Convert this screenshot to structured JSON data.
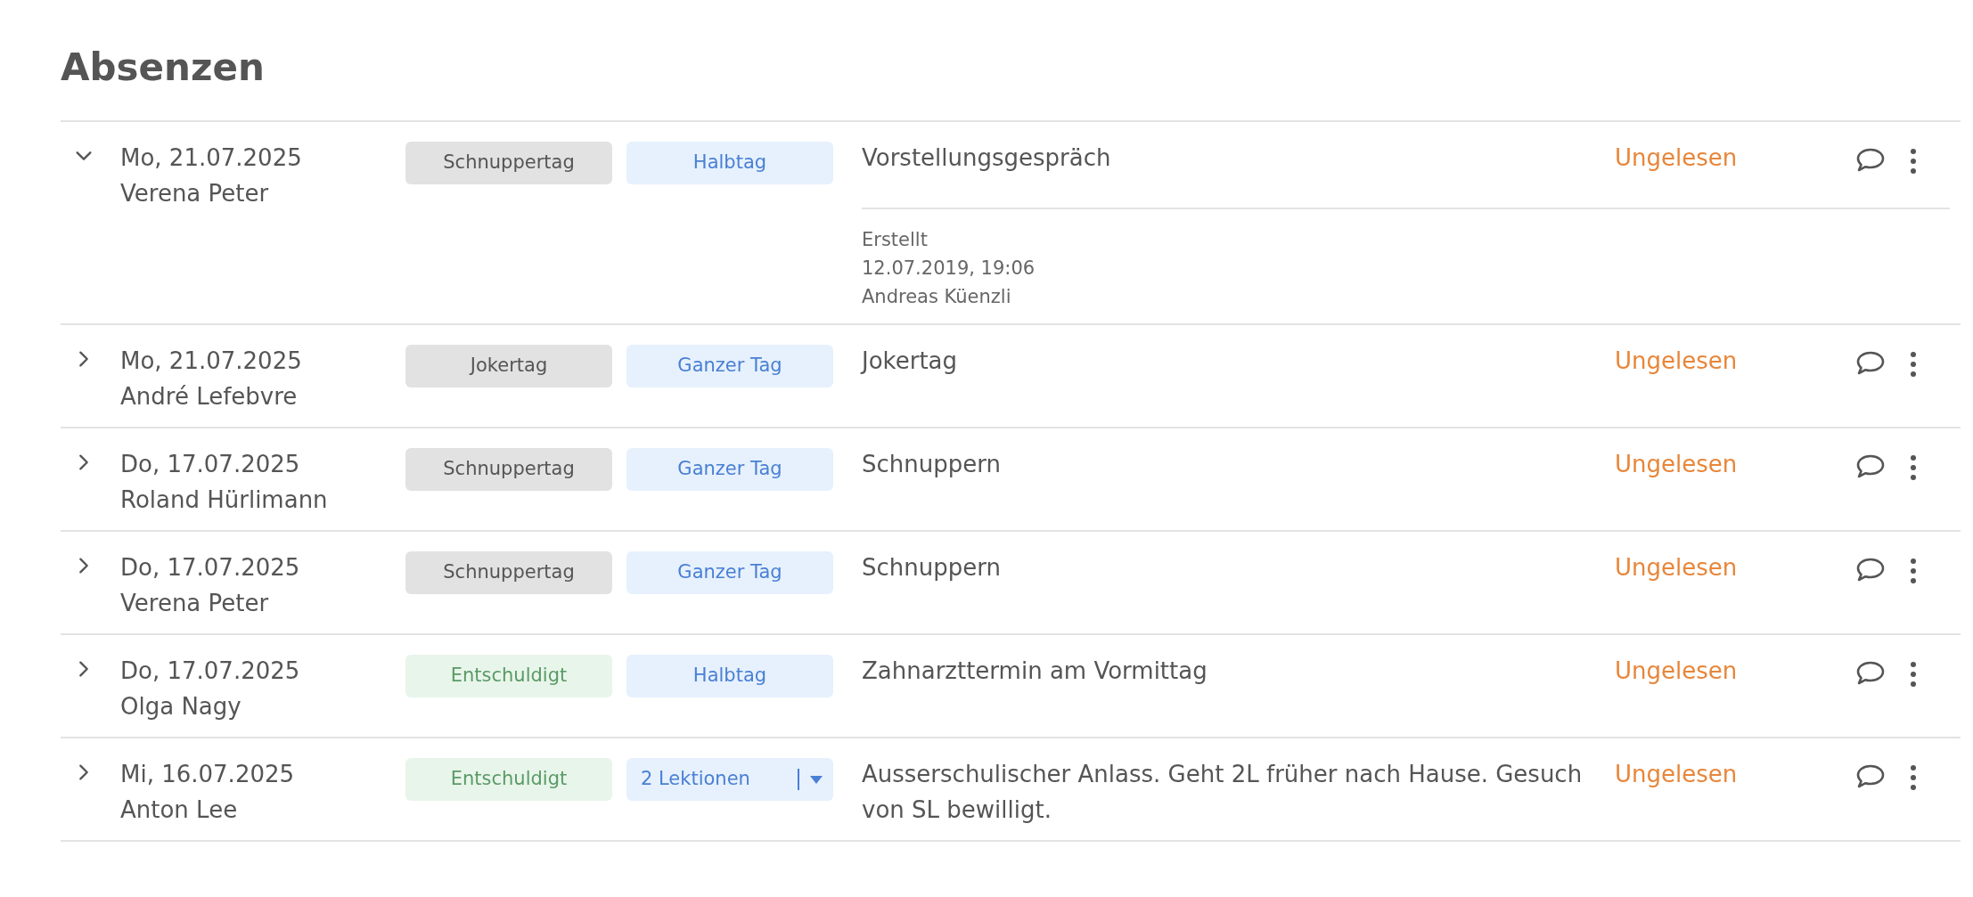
{
  "title": "Absenzen",
  "rows": [
    {
      "expanded": true,
      "date": "Mo, 21.07.2025",
      "name": "Verena Peter",
      "type": {
        "label": "Schnuppertag",
        "kind": "neutral"
      },
      "duration": {
        "label": "Halbtag",
        "kind": "plain"
      },
      "description": "Vorstellungsgespräch",
      "status": "Ungelesen",
      "details": [
        "Erstellt",
        "12.07.2019, 19:06",
        "Andreas Küenzli"
      ]
    },
    {
      "expanded": false,
      "date": "Mo, 21.07.2025",
      "name": "André Lefebvre",
      "type": {
        "label": "Jokertag",
        "kind": "neutral"
      },
      "duration": {
        "label": "Ganzer Tag",
        "kind": "plain"
      },
      "description": "Jokertag",
      "status": "Ungelesen"
    },
    {
      "expanded": false,
      "date": "Do, 17.07.2025",
      "name": "Roland Hürlimann",
      "type": {
        "label": "Schnuppertag",
        "kind": "neutral"
      },
      "duration": {
        "label": "Ganzer Tag",
        "kind": "plain"
      },
      "description": "Schnuppern",
      "status": "Ungelesen"
    },
    {
      "expanded": false,
      "date": "Do, 17.07.2025",
      "name": "Verena Peter",
      "type": {
        "label": "Schnuppertag",
        "kind": "neutral"
      },
      "duration": {
        "label": "Ganzer Tag",
        "kind": "plain"
      },
      "description": "Schnuppern",
      "status": "Ungelesen"
    },
    {
      "expanded": false,
      "date": "Do, 17.07.2025",
      "name": "Olga Nagy",
      "type": {
        "label": "Entschuldigt",
        "kind": "excused"
      },
      "duration": {
        "label": "Halbtag",
        "kind": "plain"
      },
      "description": "Zahnarzttermin am Vormittag",
      "status": "Ungelesen"
    },
    {
      "expanded": false,
      "date": "Mi, 16.07.2025",
      "name": "Anton Lee",
      "type": {
        "label": "Entschuldigt",
        "kind": "excused"
      },
      "duration": {
        "label": "2 Lektionen",
        "kind": "dropdown"
      },
      "description": "Ausserschulischer Anlass. Geht 2L früher nach Hause. Gesuch von SL bewilligt.",
      "status": "Ungelesen"
    }
  ]
}
